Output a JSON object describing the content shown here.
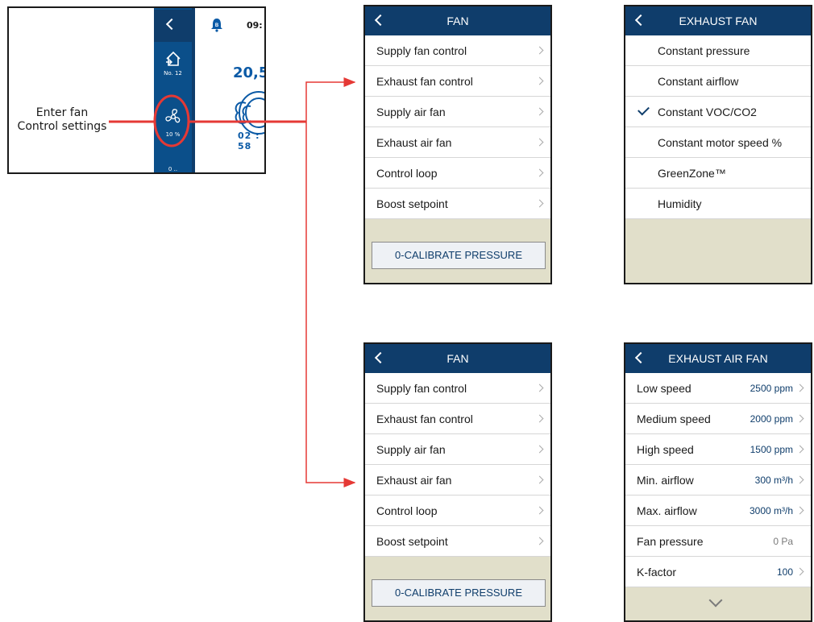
{
  "colors": {
    "header_bg": "#0f3d6b",
    "sidebar_bg": "#0b4f8a",
    "accent_blue": "#0b5aa6",
    "panel_bg": "#e1dfca",
    "annotation_red": "#e53935"
  },
  "thumbnail": {
    "time": "09:",
    "temperature": "20,5",
    "timer": "02 : 58",
    "home_label": "No. 12",
    "fan_label": "10 %",
    "bottom_label": "0 ..",
    "icons": [
      "back-chevron-icon",
      "bell-icon",
      "home-icon",
      "fan-icon",
      "fan-unit-icon"
    ]
  },
  "annotation": {
    "label_line1": "Enter fan",
    "label_line2": "Control settings"
  },
  "fan_menu_top": {
    "title": "FAN",
    "items": [
      "Supply fan control",
      "Exhaust fan control",
      "Supply air fan",
      "Exhaust air fan",
      "Control loop",
      "Boost setpoint"
    ],
    "button": "0-CALIBRATE PRESSURE"
  },
  "exhaust_fan": {
    "title": "EXHAUST FAN",
    "options": [
      "Constant pressure",
      "Constant airflow",
      "Constant VOC/CO2",
      "Constant motor speed %",
      "GreenZone™",
      "Humidity"
    ],
    "selected": "Constant VOC/CO2"
  },
  "fan_menu_bottom": {
    "title": "FAN",
    "items": [
      "Supply fan control",
      "Exhaust fan control",
      "Supply air fan",
      "Exhaust air fan",
      "Control loop",
      "Boost setpoint"
    ],
    "button": "0-CALIBRATE PRESSURE"
  },
  "exhaust_air_fan": {
    "title": "EXHAUST AIR FAN",
    "rows": [
      {
        "label": "Low speed",
        "value": "2500 ppm"
      },
      {
        "label": "Medium speed",
        "value": "2000 ppm"
      },
      {
        "label": "High speed",
        "value": "1500 ppm"
      },
      {
        "label": "Min. airflow",
        "value": "300 m³/h"
      },
      {
        "label": "Max. airflow",
        "value": "3000 m³/h"
      },
      {
        "label": "Fan pressure",
        "value": "0 Pa"
      },
      {
        "label": "K-factor",
        "value": "100"
      }
    ]
  }
}
